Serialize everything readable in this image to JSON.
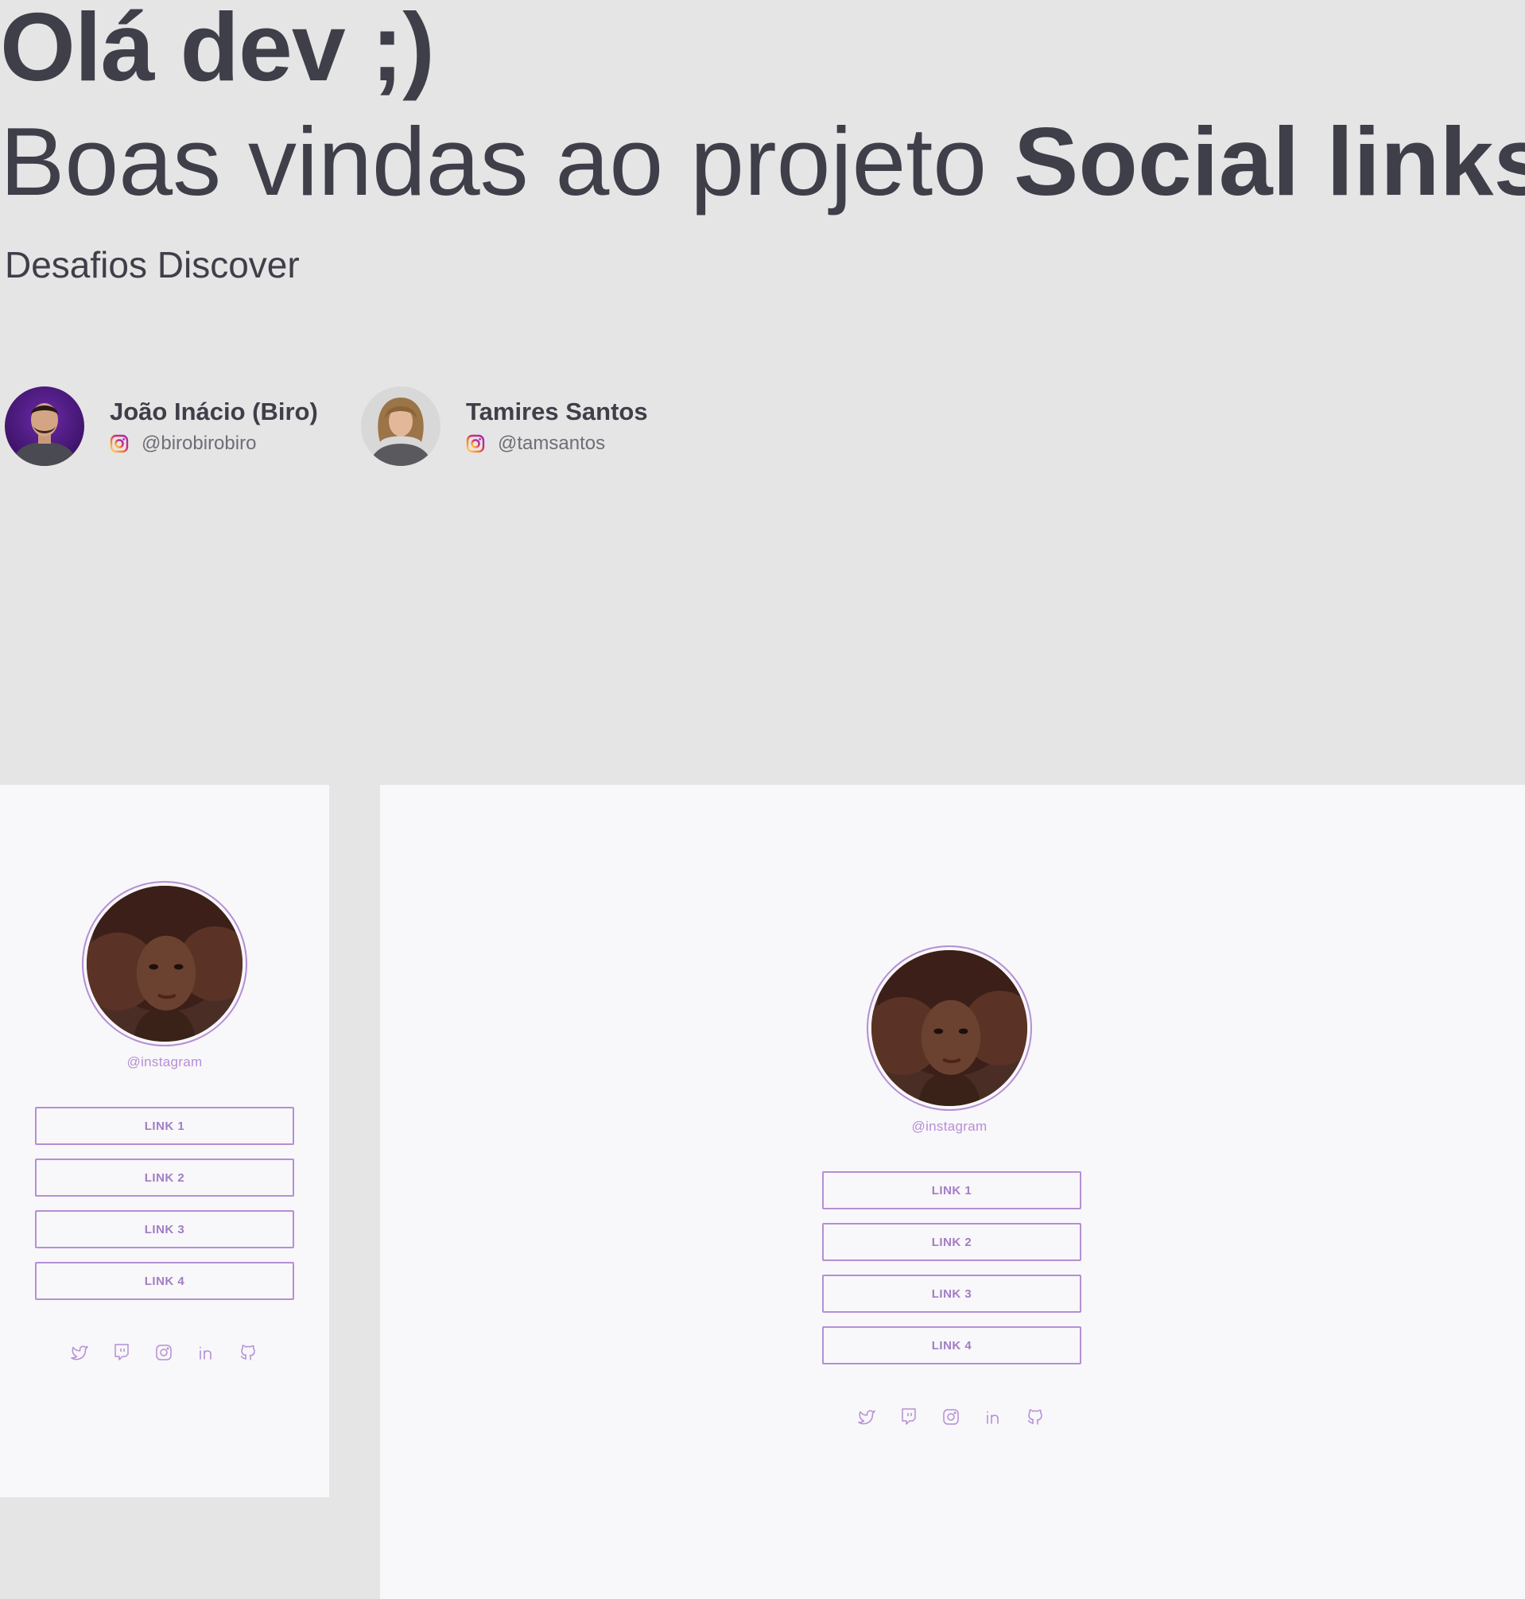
{
  "hero": {
    "greeting": "Olá dev ;)",
    "welcome_prefix": "Boas vindas ao projeto ",
    "welcome_project": "Social links",
    "tagline": "Desafios Discover"
  },
  "authors": [
    {
      "name": "João Inácio (Biro)",
      "handle": "@birobirobiro",
      "network_icon": "instagram-icon"
    },
    {
      "name": "Tamires Santos",
      "handle": "@tamsantos",
      "network_icon": "instagram-icon"
    }
  ],
  "mockups": {
    "mobile": {
      "handle": "@instagram",
      "links": [
        "LINK 1",
        "LINK 2",
        "LINK 3",
        "LINK 4"
      ],
      "social_icons": [
        "twitter-icon",
        "twitch-icon",
        "instagram-icon",
        "linkedin-icon",
        "github-icon"
      ]
    },
    "desktop": {
      "handle": "@instagram",
      "links": [
        "LINK 1",
        "LINK 2",
        "LINK 3",
        "LINK 4"
      ],
      "social_icons": [
        "twitter-icon",
        "twitch-icon",
        "instagram-icon",
        "linkedin-icon",
        "github-icon"
      ]
    }
  },
  "colors": {
    "page_background": "#e5e5e5",
    "text_dark": "#3f3f4a",
    "accent_purple": "#b58fd5",
    "mockup_background": "#f8f7fa"
  }
}
